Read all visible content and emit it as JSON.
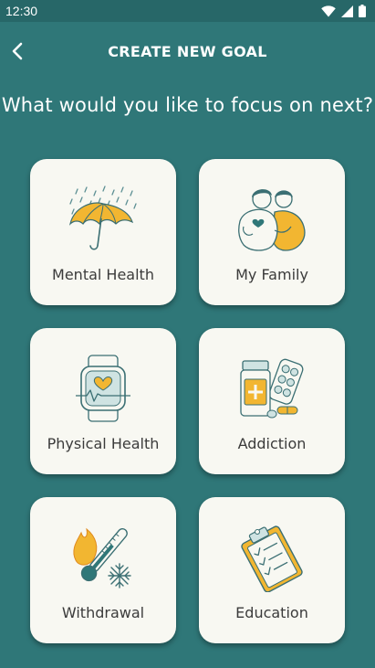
{
  "status_bar": {
    "time": "12:30",
    "icons": [
      "wifi-icon",
      "signal-icon",
      "battery-icon"
    ]
  },
  "header": {
    "back_icon": "chevron-left-icon",
    "title": "CREATE NEW GOAL"
  },
  "prompt": "What would you like to focus on next?",
  "goals": [
    {
      "label": "Mental Health",
      "icon": "umbrella-rain-icon"
    },
    {
      "label": "My Family",
      "icon": "family-hug-icon"
    },
    {
      "label": "Physical Health",
      "icon": "smartwatch-heart-icon"
    },
    {
      "label": "Addiction",
      "icon": "pills-bottle-icon"
    },
    {
      "label": "Withdrawal",
      "icon": "thermometer-fire-snow-icon"
    },
    {
      "label": "Education",
      "icon": "clipboard-checklist-icon"
    }
  ],
  "colors": {
    "background": "#2f7778",
    "card": "#f8f8f2",
    "accent_yellow": "#f2b631",
    "accent_teal": "#2f7778"
  }
}
